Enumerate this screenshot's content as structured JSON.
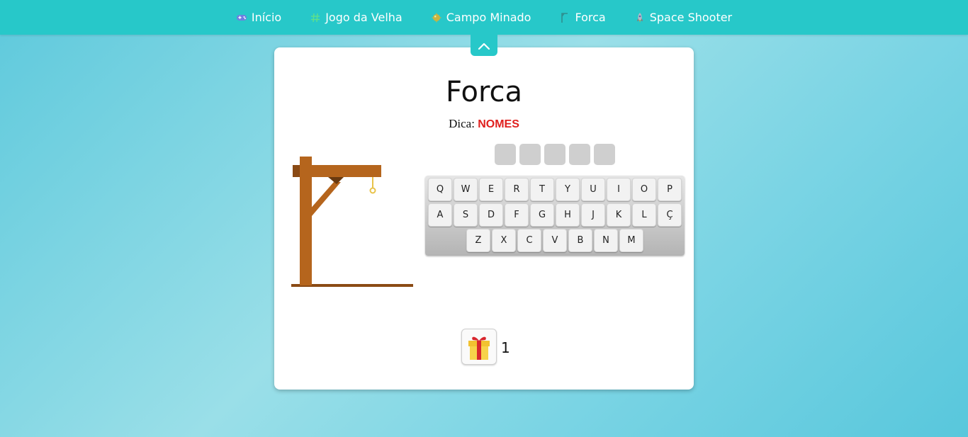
{
  "nav": {
    "items": [
      {
        "label": "Início",
        "icon": "gamepad-icon"
      },
      {
        "label": "Jogo da Velha",
        "icon": "hash-icon"
      },
      {
        "label": "Campo Minado",
        "icon": "mine-icon"
      },
      {
        "label": "Forca",
        "icon": "gallows-icon"
      },
      {
        "label": "Space Shooter",
        "icon": "rocket-icon"
      }
    ],
    "collapse_icon": "chevron-up-icon"
  },
  "game": {
    "title": "Forca",
    "hint_label": "Dica:",
    "hint_value": "NOMES",
    "word_length": 5,
    "keyboard": {
      "row1": [
        "Q",
        "W",
        "E",
        "R",
        "T",
        "Y",
        "U",
        "I",
        "O",
        "P"
      ],
      "row2": [
        "A",
        "S",
        "D",
        "F",
        "G",
        "H",
        "J",
        "K",
        "L",
        "Ç"
      ],
      "row3": [
        "Z",
        "X",
        "C",
        "V",
        "B",
        "N",
        "M"
      ]
    },
    "gift_icon": "gift-icon",
    "gift_count": "1"
  },
  "colors": {
    "nav_bg": "#27c8c9",
    "hint_value": "#e0201e",
    "gallows_wood": "#b5651d",
    "rope": "#e8c34a"
  }
}
